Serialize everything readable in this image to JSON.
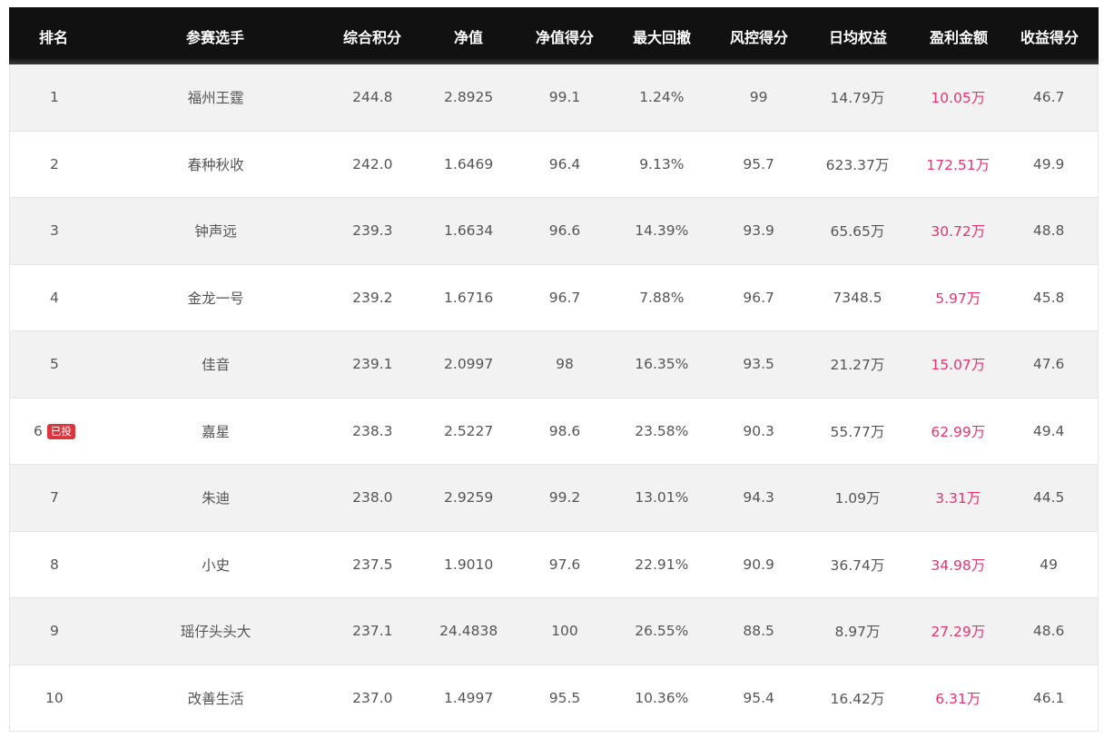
{
  "header": {
    "rank": "排名",
    "player": "参赛选手",
    "total_score": "综合积分",
    "nav": "净值",
    "nav_score": "净值得分",
    "max_drawdown": "最大回撤",
    "risk_score": "风控得分",
    "daily_equity": "日均权益",
    "profit": "盈利金额",
    "return_score": "收益得分"
  },
  "colors": {
    "profit": "#e8336f",
    "badge": "#d9363e",
    "header_bg": "#111111"
  },
  "rows": [
    {
      "rank": "1",
      "badge": "",
      "player": "福州王霆",
      "total_score": "244.8",
      "nav": "2.8925",
      "nav_score": "99.1",
      "max_drawdown": "1.24%",
      "risk_score": "99",
      "daily_equity": "14.79万",
      "profit": "10.05万",
      "return_score": "46.7"
    },
    {
      "rank": "2",
      "badge": "",
      "player": "春种秋收",
      "total_score": "242.0",
      "nav": "1.6469",
      "nav_score": "96.4",
      "max_drawdown": "9.13%",
      "risk_score": "95.7",
      "daily_equity": "623.37万",
      "profit": "172.51万",
      "return_score": "49.9"
    },
    {
      "rank": "3",
      "badge": "",
      "player": "钟声远",
      "total_score": "239.3",
      "nav": "1.6634",
      "nav_score": "96.6",
      "max_drawdown": "14.39%",
      "risk_score": "93.9",
      "daily_equity": "65.65万",
      "profit": "30.72万",
      "return_score": "48.8"
    },
    {
      "rank": "4",
      "badge": "",
      "player": "金龙一号",
      "total_score": "239.2",
      "nav": "1.6716",
      "nav_score": "96.7",
      "max_drawdown": "7.88%",
      "risk_score": "96.7",
      "daily_equity": "7348.5",
      "profit": "5.97万",
      "return_score": "45.8"
    },
    {
      "rank": "5",
      "badge": "",
      "player": "佳音",
      "total_score": "239.1",
      "nav": "2.0997",
      "nav_score": "98",
      "max_drawdown": "16.35%",
      "risk_score": "93.5",
      "daily_equity": "21.27万",
      "profit": "15.07万",
      "return_score": "47.6"
    },
    {
      "rank": "6",
      "badge": "已投",
      "player": "嘉星",
      "total_score": "238.3",
      "nav": "2.5227",
      "nav_score": "98.6",
      "max_drawdown": "23.58%",
      "risk_score": "90.3",
      "daily_equity": "55.77万",
      "profit": "62.99万",
      "return_score": "49.4"
    },
    {
      "rank": "7",
      "badge": "",
      "player": "朱迪",
      "total_score": "238.0",
      "nav": "2.9259",
      "nav_score": "99.2",
      "max_drawdown": "13.01%",
      "risk_score": "94.3",
      "daily_equity": "1.09万",
      "profit": "3.31万",
      "return_score": "44.5"
    },
    {
      "rank": "8",
      "badge": "",
      "player": "小史",
      "total_score": "237.5",
      "nav": "1.9010",
      "nav_score": "97.6",
      "max_drawdown": "22.91%",
      "risk_score": "90.9",
      "daily_equity": "36.74万",
      "profit": "34.98万",
      "return_score": "49"
    },
    {
      "rank": "9",
      "badge": "",
      "player": "瑶仔头头大",
      "total_score": "237.1",
      "nav": "24.4838",
      "nav_score": "100",
      "max_drawdown": "26.55%",
      "risk_score": "88.5",
      "daily_equity": "8.97万",
      "profit": "27.29万",
      "return_score": "48.6"
    },
    {
      "rank": "10",
      "badge": "",
      "player": "改善生活",
      "total_score": "237.0",
      "nav": "1.4997",
      "nav_score": "95.5",
      "max_drawdown": "10.36%",
      "risk_score": "95.4",
      "daily_equity": "16.42万",
      "profit": "6.31万",
      "return_score": "46.1"
    }
  ]
}
